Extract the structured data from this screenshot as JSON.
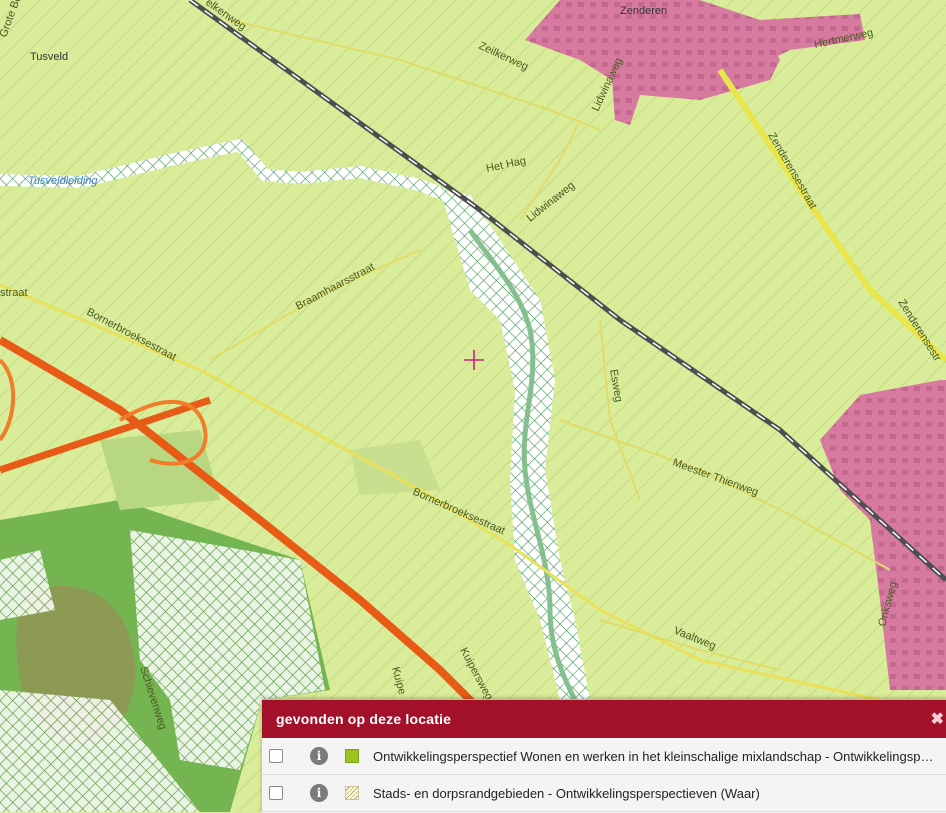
{
  "map": {
    "place_labels": {
      "tusveld": "Tusveld",
      "zenderen": "Zenderen",
      "hertmerweg": "Hertmerweg",
      "zeilkerweg": "Zeilkerweg",
      "lidwinaweg_north": "Lidwinaweg",
      "lidwinaweg_south": "Lidwinaweg",
      "het_hag": "Het Hag",
      "zenderensestraat_north": "Zenderensestraat",
      "zenderensestraat_south": "Zenderensestr",
      "tusveldleiding": "Tusveldleiding",
      "braamhaarsstraat": "Braamhaarsstraat",
      "straat_partial": "straat",
      "bornerbroeksestraat_west": "Bornerbroeksestraat",
      "bornerbroeksestraat_east": "Bornerbroeksestraat",
      "esweg": "Esweg",
      "meester_thienweg": "Meester Thienweg",
      "vaaltweg": "Vaaltweg",
      "onksweg": "Onksweg",
      "kuipersweg": "Kuipersweg",
      "kuipers_partial": "Kuipe",
      "schievenweg": "Schievenweg",
      "grote_boe": "Grote Boe",
      "elkenweg": "elkenweg"
    },
    "colors": {
      "land": "#d9ec9a",
      "hatch": "#b9cf78",
      "urban": "#d77aa0",
      "motorway": "#ee5a1a",
      "forest": "#6fae4e",
      "railway": "#555555"
    }
  },
  "panel": {
    "title": "gevonden op deze locatie",
    "close_glyph": "✖",
    "info_glyph": "i",
    "rows": [
      {
        "label": "Ontwikkelingsperspectief Wonen en werken in het kleinschalige mixlandschap - Ontwikkelingsperspectieven (Waar)",
        "swatch": "green"
      },
      {
        "label": "Stads- en dorpsrandgebieden - Ontwikkelingsperspectieven (Waar)",
        "swatch": "hatch"
      }
    ]
  }
}
